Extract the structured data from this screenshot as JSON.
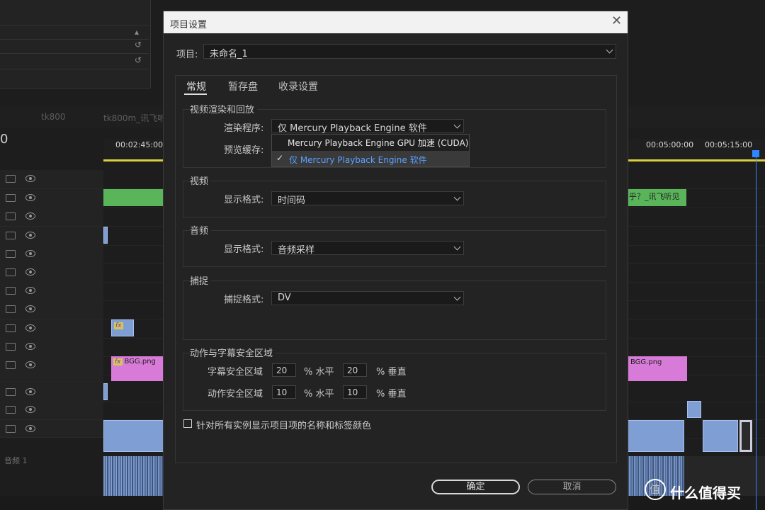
{
  "background": {
    "tabs": [
      "tk800",
      "tk800m_讯飞听"
    ],
    "timecode": "0",
    "ruler_ticks": [
      "00:02:45:00",
      "00:05:00:00",
      "00:05:15:00"
    ],
    "clips": {
      "green_caption_text": "乎？_讯飞听见",
      "bgg_left": "BGG.png",
      "bgg_right": "BGG.png",
      "fx_badge": "fx"
    },
    "audio_track_label": "音频 1",
    "watermark": "什么值得买",
    "watermark_logo": "值"
  },
  "dialog": {
    "title": "项目设置",
    "close_symbol": "✕",
    "project_label": "项目:",
    "project_value": "未命名_1",
    "tabs": [
      "常规",
      "暂存盘",
      "收录设置"
    ],
    "active_tab": "常规",
    "groups": {
      "render": {
        "title": "视频渲染和回放",
        "renderer_label": "渲染程序:",
        "renderer_value": "仅 Mercury Playback Engine 软件",
        "preview_cache_label": "预览缓存:"
      },
      "video": {
        "title": "视频",
        "display_format_label": "显示格式:",
        "display_format_value": "时间码"
      },
      "audio": {
        "title": "音频",
        "display_format_label": "显示格式:",
        "display_format_value": "音频采样"
      },
      "capture": {
        "title": "捕捉",
        "capture_format_label": "捕捉格式:",
        "capture_format_value": "DV"
      },
      "safe_area": {
        "title": "动作与字幕安全区域",
        "title_safe_label": "字幕安全区域",
        "title_safe_h": "20",
        "title_safe_v": "20",
        "action_safe_label": "动作安全区域",
        "action_safe_h": "10",
        "action_safe_v": "10",
        "horizontal_unit": "% 水平",
        "vertical_unit": "% 垂直"
      }
    },
    "renderer_dropdown": {
      "options": [
        "Mercury Playback Engine GPU 加速 (CUDA)",
        "仅 Mercury Playback Engine 软件"
      ],
      "selected_index": 1,
      "check_symbol": "✓"
    },
    "show_names_checkbox": {
      "label": "针对所有实例显示项目项的名称和标签颜色",
      "checked": false
    },
    "buttons": {
      "ok": "确定",
      "cancel": "取消"
    }
  }
}
